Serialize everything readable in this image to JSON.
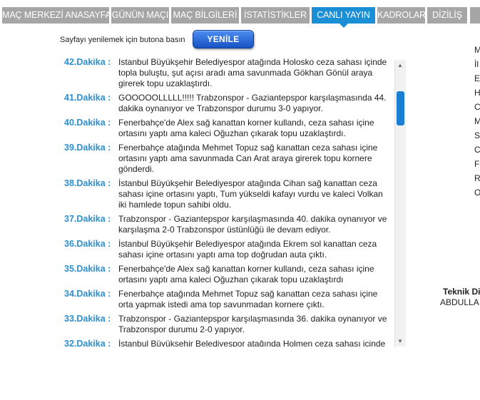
{
  "tabs": [
    {
      "label": "MAÇ MERKEZİ ANASAYFA"
    },
    {
      "label": "GÜNÜN MAÇI"
    },
    {
      "label": "MAÇ BİLGİLERİ"
    },
    {
      "label": "İSTATİSTİKLER"
    },
    {
      "label": "CANLI YAYIN"
    },
    {
      "label": "KADROLAR"
    },
    {
      "label": "DİZİLİŞ"
    }
  ],
  "refresh": {
    "text": "Sayfayı yenilemek için butona basın",
    "button_label": "YENİLE"
  },
  "feed": [
    {
      "minute": "42.Dakika :",
      "text": "İstanbul Büyükşehir Belediyespor atağında Holosko ceza sahası içinde topla buluştu, şut açısı aradı ama savunmada Gökhan Gönül araya girerek topu uzaklaştırdı."
    },
    {
      "minute": "41.Dakika :",
      "text": "GOOOOOLLLLL!!!!! Trabzonspor - Gaziantepspor karşılaşmasında 44. dakika oynanıyor ve Trabzonspor durumu 3-0 yapıyor."
    },
    {
      "minute": "40.Dakika :",
      "text": "Fenerbahçe'de Alex sağ kanattan korner kullandı, ceza sahası içine ortasını yaptı ama kaleci Oğuzhan çıkarak topu uzaklaştırdı."
    },
    {
      "minute": "39.Dakika :",
      "text": "Fenerbahçe atağında Mehmet Topuz sağ kanattan ceza sahası içine ortasını yaptı ama savunmada Can Arat araya girerek topu kornere gönderdi."
    },
    {
      "minute": "38.Dakika :",
      "text": "İstanbul Büyükşehir Belediyespor atağında Cihan sağ kanattan ceza sahası içine ortasını yaptı, Tum yükseldi kafayı vurdu ve kaleci Volkan iki hamlede topun sahibi oldu."
    },
    {
      "minute": "37.Dakika :",
      "text": "Trabzonspor - Gaziantepspor karşılaşmasında 40. dakika oynanıyor ve karşılaşma 2-0 Trabzonspor üstünlüğü ile devam ediyor."
    },
    {
      "minute": "36.Dakika :",
      "text": "İstanbul Büyükşehir Belediyespor atağında Ekrem sol kanattan ceza sahası içine ortasını yaptı ama top doğrudan auta çıktı."
    },
    {
      "minute": "35.Dakika :",
      "text": "Fenerbahçe'de Alex sağ kanattan korner kullandı, ceza sahası içine ortasını yaptı ama kaleci Oğuzhan çıkarak topu uzaklaştırdı"
    },
    {
      "minute": "34.Dakika :",
      "text": "Fenerbahçe atağında Mehmet Topuz sağ kanattan ceza sahası içine orta yapmak istedi ama top savunmadan kornere çıktı."
    },
    {
      "minute": "33.Dakika :",
      "text": "Trabzonspor - Gaziantepspor karşılaşmasında 36. dakika oynanıyor ve Trabzonspor durumu 2-0 yapıyor."
    },
    {
      "minute": "32.Dakika :",
      "text": "İstanbul Büyükşehir Belediyespor atağında Holmen ceza sahası içinde"
    }
  ],
  "side_letters": [
    "M",
    "İl",
    "E",
    "H",
    "C",
    "M",
    "S",
    "C",
    "F",
    "R",
    "O"
  ],
  "tech": {
    "title": "Teknik Di",
    "name": "ABDULLA"
  }
}
